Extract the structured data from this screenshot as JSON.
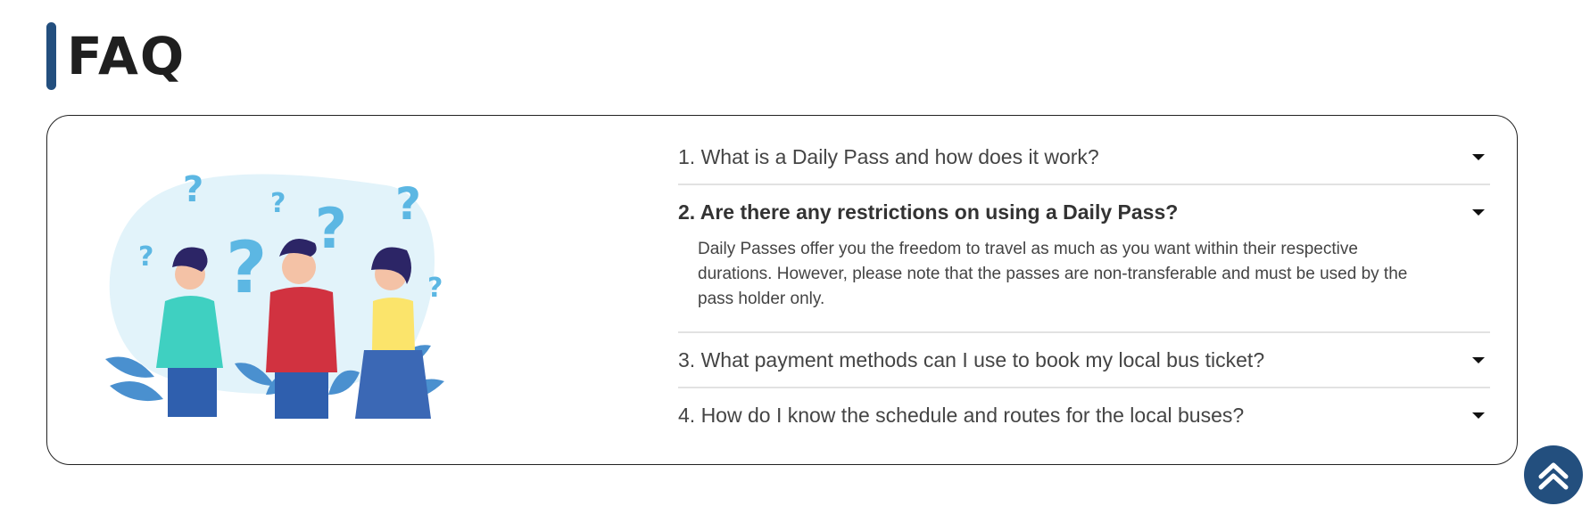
{
  "header": {
    "title": "FAQ"
  },
  "faq": {
    "items": [
      {
        "question": "1. What is a Daily Pass and how does it work?",
        "expanded": false
      },
      {
        "question": "2. Are there any restrictions on using a Daily Pass?",
        "expanded": true,
        "answer": "Daily Passes offer you the freedom to travel as much as you want within their respective durations. However, please note that the passes are non-transferable and must be used by the pass holder only."
      },
      {
        "question": "3. What payment methods can I use to book my local bus ticket?",
        "expanded": false
      },
      {
        "question": "4. How do I know the schedule and routes for the local buses?",
        "expanded": false
      }
    ]
  },
  "icons": {
    "expand": "caret-down-icon",
    "scroll_top": "double-chevron-up-icon"
  },
  "colors": {
    "accent": "#234f7e",
    "border": "#222222",
    "divider": "#e2e2e2"
  }
}
